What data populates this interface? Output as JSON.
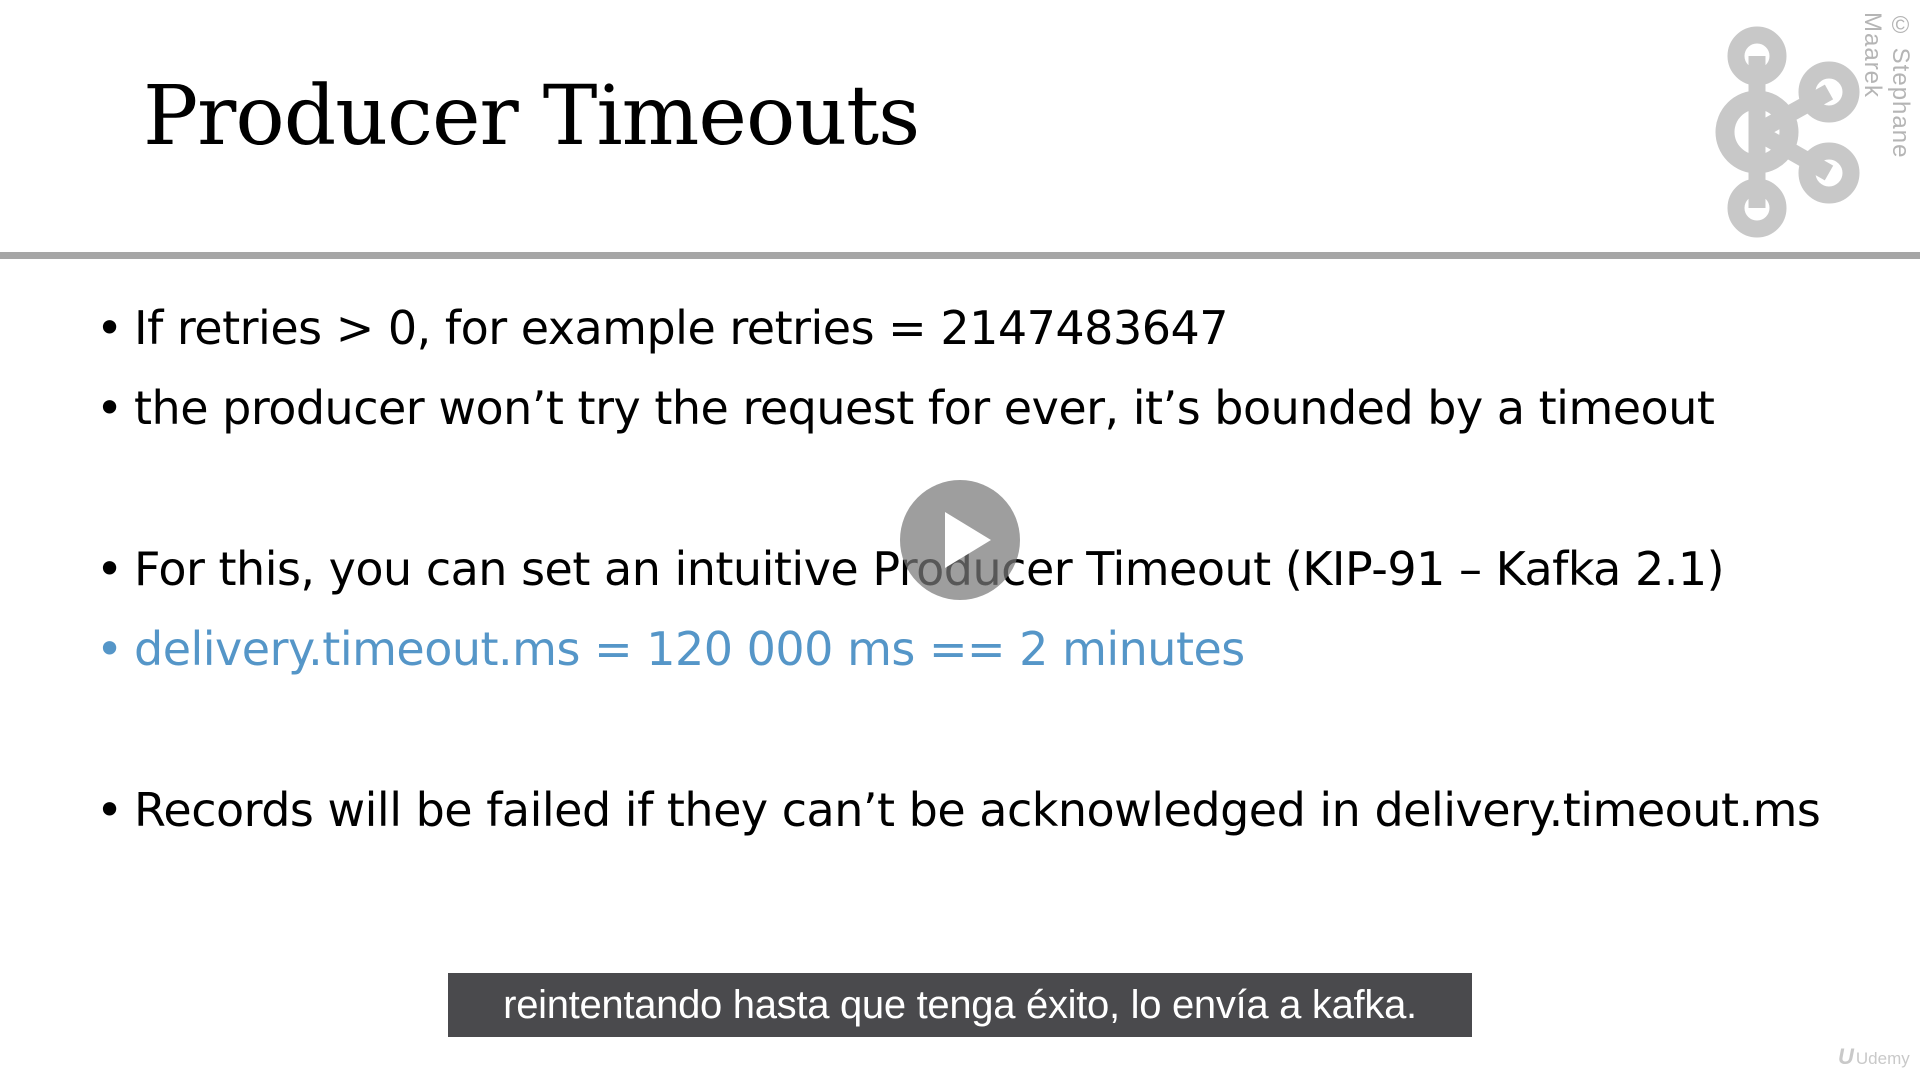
{
  "slide": {
    "title": "Producer Timeouts",
    "copyright": "© Stephane Maarek",
    "bullets": [
      "If retries > 0, for example retries = 2147483647",
      "the producer won’t try the request for ever, it’s bounded by a timeout",
      "For this, you can set an intuitive Producer Timeout (KIP-91 – Kafka 2.1)",
      "delivery.timeout.ms = 120 000 ms  == 2 minutes",
      "Records will be failed if they can’t be acknowledged in delivery.timeout.ms"
    ],
    "highlight_color": "#5596c8"
  },
  "player": {
    "caption": "reintentando hasta que tenga éxito, lo envía a kafka.",
    "play_icon": "play-icon",
    "watermark_mark": "U",
    "watermark_text": "Udemy"
  },
  "icons": {
    "logo": "kafka-logo"
  }
}
